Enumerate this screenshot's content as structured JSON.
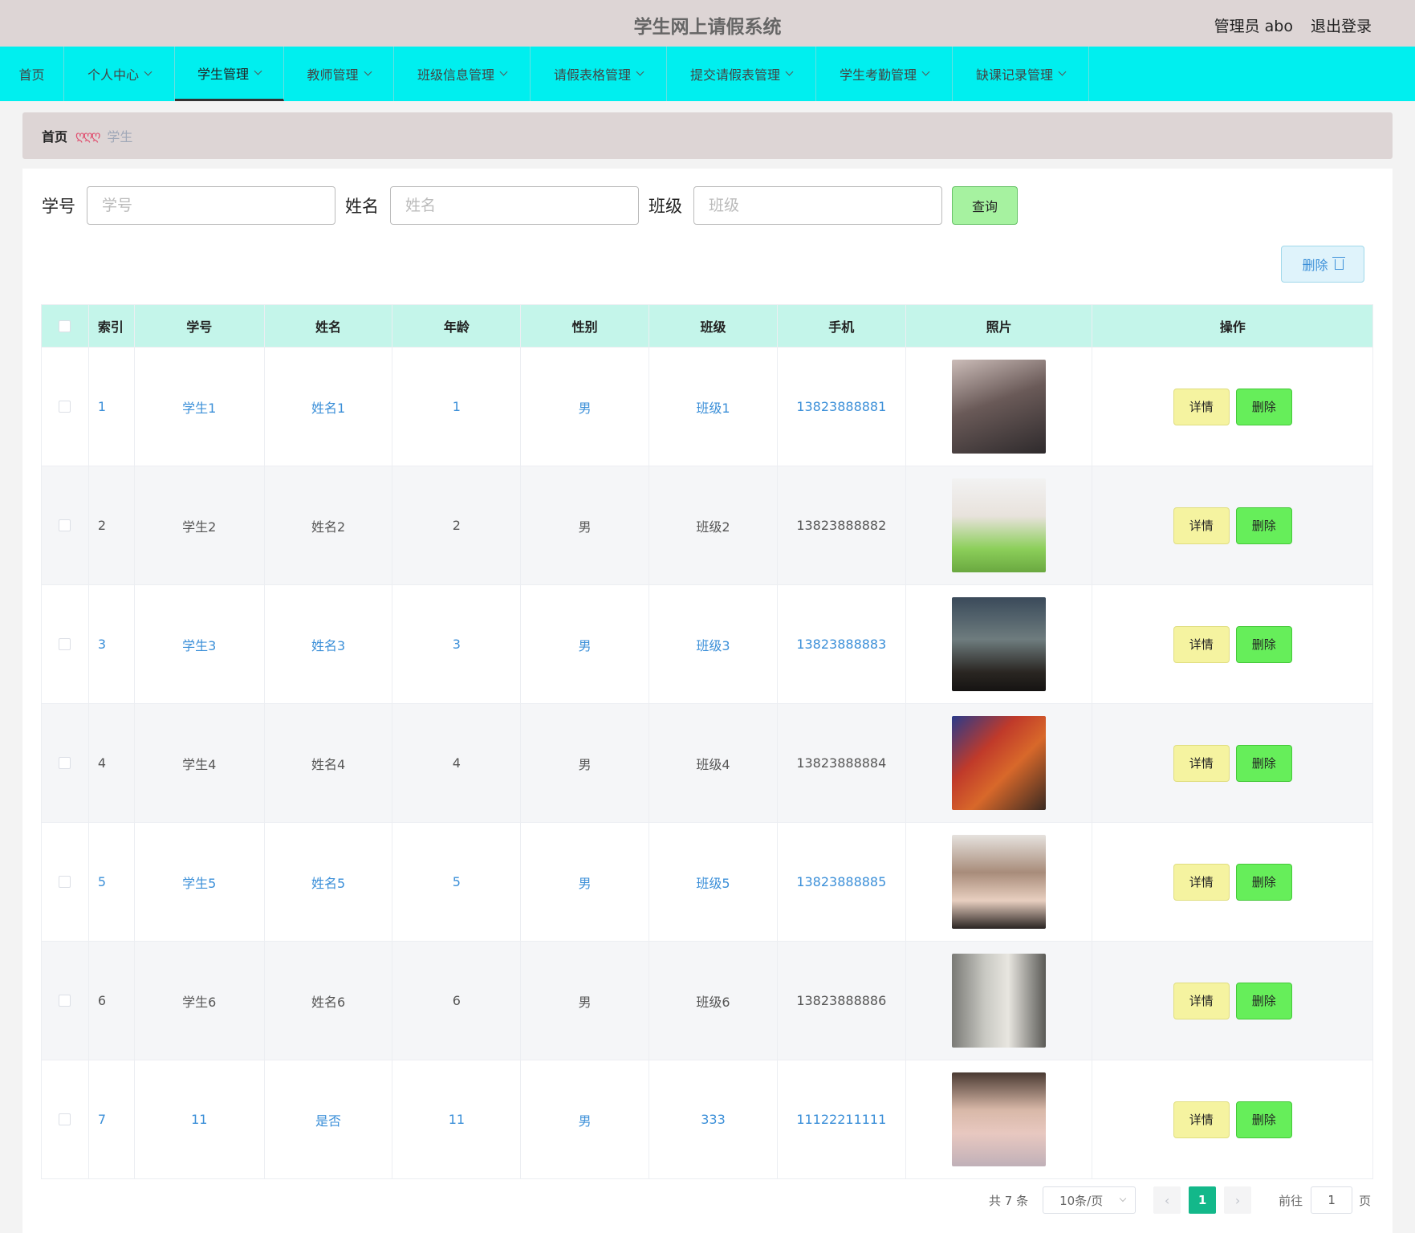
{
  "header": {
    "title": "学生网上请假系统",
    "user": "管理员 abo",
    "logout": "退出登录"
  },
  "nav": [
    {
      "label": "首页",
      "dropdown": false
    },
    {
      "label": "个人中心",
      "dropdown": true
    },
    {
      "label": "学生管理",
      "dropdown": true,
      "active": true
    },
    {
      "label": "教师管理",
      "dropdown": true
    },
    {
      "label": "班级信息管理",
      "dropdown": true
    },
    {
      "label": "请假表格管理",
      "dropdown": true
    },
    {
      "label": "提交请假表管理",
      "dropdown": true
    },
    {
      "label": "学生考勤管理",
      "dropdown": true
    },
    {
      "label": "缺课记录管理",
      "dropdown": true
    }
  ],
  "breadcrumb": {
    "home": "首页",
    "separator": "ღღღ",
    "current": "学生"
  },
  "search": {
    "sno_label": "学号",
    "sno_placeholder": "学号",
    "name_label": "姓名",
    "name_placeholder": "姓名",
    "class_label": "班级",
    "class_placeholder": "班级",
    "query_button": "查询"
  },
  "batch_delete": "删除",
  "table": {
    "columns": [
      "索引",
      "学号",
      "姓名",
      "年龄",
      "性别",
      "班级",
      "手机",
      "照片",
      "操作"
    ],
    "rows": [
      {
        "index": "1",
        "sno": "学生1",
        "name": "姓名1",
        "age": "1",
        "sex": "男",
        "class": "班级1",
        "phone": "13823888881"
      },
      {
        "index": "2",
        "sno": "学生2",
        "name": "姓名2",
        "age": "2",
        "sex": "男",
        "class": "班级2",
        "phone": "13823888882"
      },
      {
        "index": "3",
        "sno": "学生3",
        "name": "姓名3",
        "age": "3",
        "sex": "男",
        "class": "班级3",
        "phone": "13823888883"
      },
      {
        "index": "4",
        "sno": "学生4",
        "name": "姓名4",
        "age": "4",
        "sex": "男",
        "class": "班级4",
        "phone": "13823888884"
      },
      {
        "index": "5",
        "sno": "学生5",
        "name": "姓名5",
        "age": "5",
        "sex": "男",
        "class": "班级5",
        "phone": "13823888885"
      },
      {
        "index": "6",
        "sno": "学生6",
        "name": "姓名6",
        "age": "6",
        "sex": "男",
        "class": "班级6",
        "phone": "13823888886"
      },
      {
        "index": "7",
        "sno": "11",
        "name": "是否",
        "age": "11",
        "sex": "男",
        "class": "333",
        "phone": "11122211111"
      }
    ],
    "detail_button": "详情",
    "delete_button": "删除"
  },
  "pagination": {
    "total": "共 7 条",
    "page_size": "10条/页",
    "current_page": "1",
    "goto_label": "前往",
    "goto_value": "1",
    "page_suffix": "页"
  },
  "colors": {
    "nav_bg": "#00efef",
    "header_bg": "#ddd5d5",
    "table_head_bg": "#c4f5ea",
    "link_blue": "#3b8fd8",
    "pager_active": "#13b88a"
  }
}
